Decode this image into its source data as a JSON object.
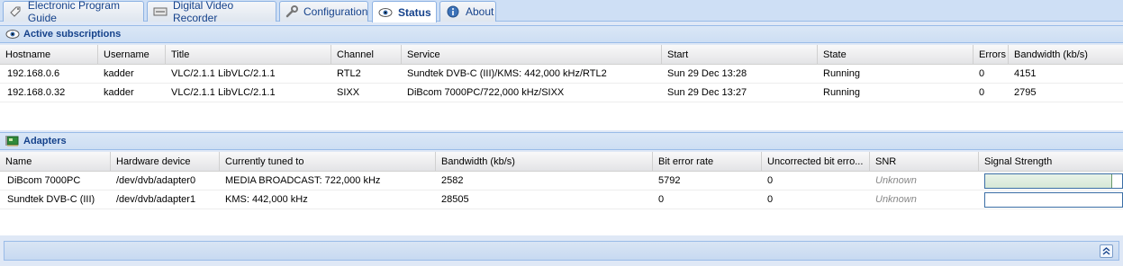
{
  "tabs": [
    {
      "label": "Electronic Program Guide",
      "icon": "epg-tag-icon"
    },
    {
      "label": "Digital Video Recorder",
      "icon": "dvr-recorder-icon"
    },
    {
      "label": "Configuration",
      "icon": "wrench-icon"
    },
    {
      "label": "Status",
      "icon": "eye-icon",
      "active": true
    },
    {
      "label": "About",
      "icon": "info-icon"
    }
  ],
  "subscriptions": {
    "title": "Active subscriptions",
    "columns": [
      "Hostname",
      "Username",
      "Title",
      "Channel",
      "Service",
      "Start",
      "State",
      "Errors",
      "Bandwidth (kb/s)"
    ],
    "rows": [
      [
        "192.168.0.6",
        "kadder",
        "VLC/2.1.1 LibVLC/2.1.1",
        "RTL2",
        "Sundtek DVB-C (III)/KMS: 442,000 kHz/RTL2",
        "Sun 29 Dec 13:28",
        "Running",
        "0",
        "4151"
      ],
      [
        "192.168.0.32",
        "kadder",
        "VLC/2.1.1 LibVLC/2.1.1",
        "SIXX",
        "DiBcom 7000PC/722,000 kHz/SIXX",
        "Sun 29 Dec 13:27",
        "Running",
        "0",
        "2795"
      ]
    ]
  },
  "adapters": {
    "title": "Adapters",
    "columns": [
      "Name",
      "Hardware device",
      "Currently tuned to",
      "Bandwidth (kb/s)",
      "Bit error rate",
      "Uncorrected bit erro...",
      "SNR",
      "Signal Strength"
    ],
    "rows": [
      {
        "cells": [
          "DiBcom 7000PC",
          "/dev/dvb/adapter0",
          "MEDIA BROADCAST: 722,000 kHz",
          "2582",
          "5792",
          "0",
          "Unknown"
        ],
        "signal": 0.93
      },
      {
        "cells": [
          "Sundtek DVB-C (III)",
          "/dev/dvb/adapter1",
          "KMS: 442,000 kHz",
          "28505",
          "0",
          "0",
          "Unknown"
        ],
        "signal": 0
      }
    ]
  },
  "colors": {
    "header_text": "#15428b",
    "unknown_text": "#888888"
  }
}
